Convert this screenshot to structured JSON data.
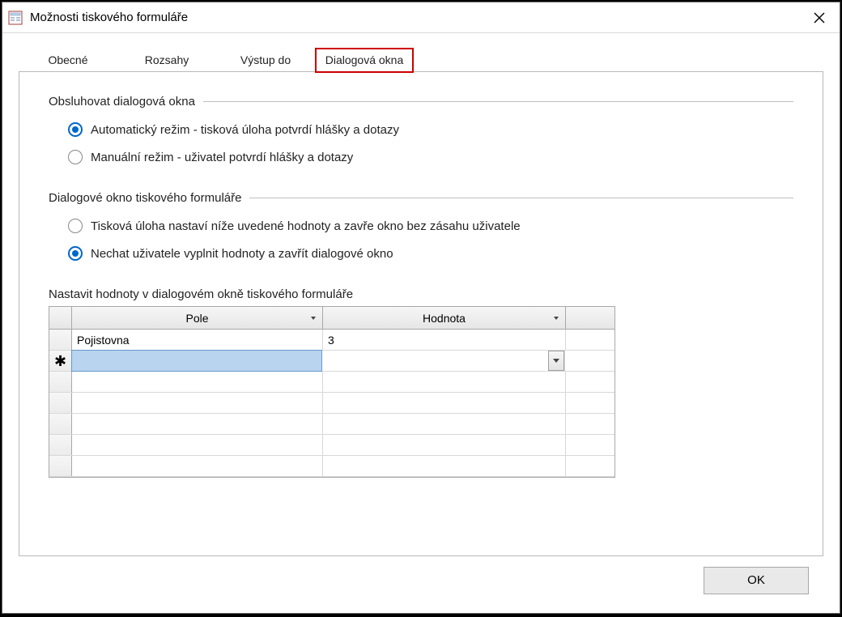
{
  "window": {
    "title": "Možnosti tiskového formuláře"
  },
  "tabs": {
    "general": "Obecné",
    "ranges": "Rozsahy",
    "output": "Výstup do",
    "dialogs": "Dialogová okna"
  },
  "group1": {
    "title": "Obsluhovat dialogová okna",
    "opt_auto": "Automatický režim - tisková úloha potvrdí hlášky a dotazy",
    "opt_manual": "Manuální režim - uživatel potvrdí hlášky a dotazy"
  },
  "group2": {
    "title": "Dialogové okno tiskového formuláře",
    "opt_auto": "Tisková úloha nastaví níže uvedené hodnoty a zavře okno bez zásahu uživatele",
    "opt_manual": "Nechat uživatele vyplnit hodnoty a zavřít dialogové okno"
  },
  "grid": {
    "heading": "Nastavit hodnoty v dialogovém okně tiskového formuláře",
    "col_field": "Pole",
    "col_value": "Hodnota",
    "rows": [
      {
        "field": "Pojistovna",
        "value": "3"
      }
    ]
  },
  "buttons": {
    "ok": "OK"
  }
}
